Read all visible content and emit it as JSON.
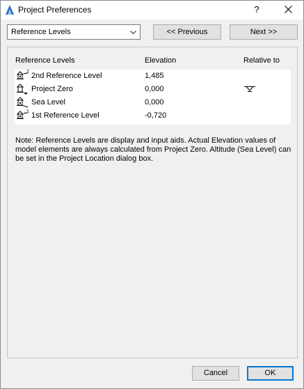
{
  "window": {
    "title": "Project Preferences",
    "help_label": "?",
    "accent": "#0078d7"
  },
  "toolbar": {
    "dropdown_value": "Reference Levels",
    "prev_label": "<< Previous",
    "next_label": "Next >>"
  },
  "table": {
    "columns": [
      "Reference Levels",
      "Elevation",
      "Relative to"
    ],
    "rows": [
      {
        "icon": "reference-level-2-icon",
        "name": "2nd Reference Level",
        "elevation": "1,485"
      },
      {
        "icon": "project-zero-icon",
        "name": "Project Zero",
        "elevation": "0,000",
        "relative": "relative-to-marker-icon"
      },
      {
        "icon": "sea-level-icon",
        "name": "Sea Level",
        "elevation": "0,000"
      },
      {
        "icon": "reference-level-1-icon",
        "name": "1st Reference Level",
        "elevation": "-0,720"
      }
    ]
  },
  "note": "Note: Reference Levels are display and input aids. Actual Elevation values of model elements are always calculated from Project Zero. Altitude (Sea Level) can be set in the Project Location dialog box.",
  "footer": {
    "cancel_label": "Cancel",
    "ok_label": "OK"
  }
}
